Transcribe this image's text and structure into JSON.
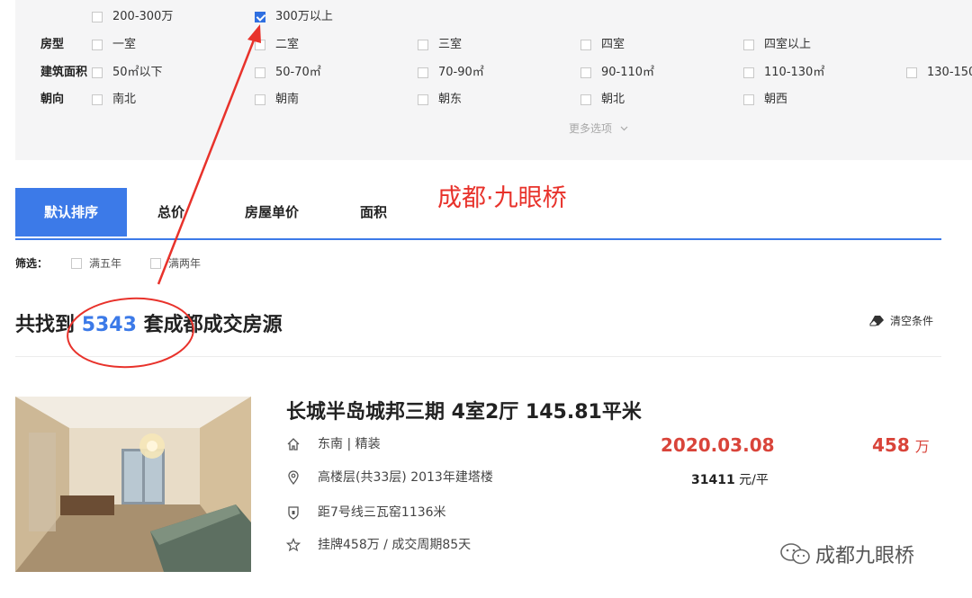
{
  "filters": {
    "price_row": {
      "options": [
        {
          "label": "200-300万",
          "checked": false
        },
        {
          "label": "300万以上",
          "checked": true
        }
      ]
    },
    "layout_row": {
      "label": "房型",
      "options": [
        "一室",
        "二室",
        "三室",
        "四室",
        "四室以上"
      ]
    },
    "area_row": {
      "label": "建筑面积",
      "options": [
        "50㎡以下",
        "50-70㎡",
        "70-90㎡",
        "90-110㎡",
        "110-130㎡",
        "130-150"
      ]
    },
    "orientation_row": {
      "label": "朝向",
      "options": [
        "南北",
        "朝南",
        "朝东",
        "朝北",
        "朝西"
      ]
    },
    "more_label": "更多选项"
  },
  "sort_tabs": [
    "默认排序",
    "总价",
    "房屋单价",
    "面积"
  ],
  "secondary_filter": {
    "label": "筛选：",
    "options": [
      "满五年",
      "满两年"
    ]
  },
  "result": {
    "prefix": "共找到",
    "count": "5343",
    "suffix": "套成都成交房源",
    "clear_label": "清空条件"
  },
  "listing": {
    "title": "长城半岛城邦三期 4室2厅 145.81平米",
    "orientation_decoration": "东南 | 精装",
    "floor_info": "高楼层(共33层) 2013年建塔楼",
    "subway": "距7号线三瓦窑1136米",
    "listing_info": "挂牌458万 / 成交周期85天",
    "deal_date": "2020.03.08",
    "unit_price_value": "31411",
    "unit_price_unit": "元/平",
    "total_price_value": "458",
    "total_price_unit": "万"
  },
  "annotation": {
    "text": "成都·九眼桥",
    "color": "#e8322b"
  },
  "watermark": {
    "text": "成都九眼桥"
  },
  "colors": {
    "accent_blue": "#3c7ae8",
    "price_red": "#d9443a",
    "panel_bg": "#f5f5f6"
  }
}
